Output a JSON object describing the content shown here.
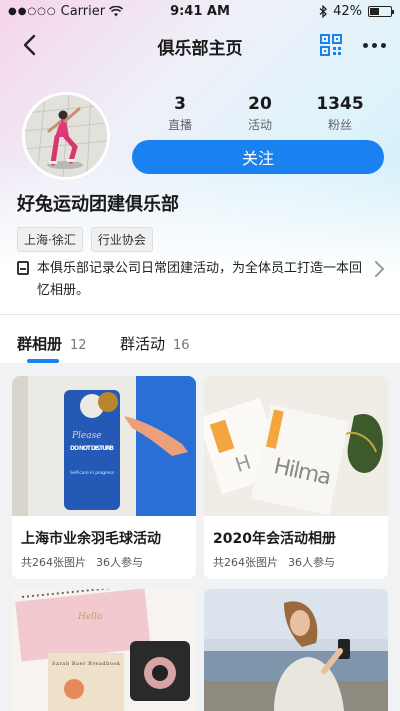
{
  "status": {
    "carrier": "Carrier",
    "time": "9:41 AM",
    "battery": "42%"
  },
  "nav": {
    "title": "俱乐部主页"
  },
  "stats": [
    {
      "num": "3",
      "label": "直播"
    },
    {
      "num": "20",
      "label": "活动"
    },
    {
      "num": "1345",
      "label": "粉丝"
    }
  ],
  "follow_label": "关注",
  "club": {
    "name": "好兔运动团建俱乐部",
    "tags": [
      "上海·徐汇",
      "行业协会"
    ],
    "description": "本俱乐部记录公司日常团建活动，为全体员工打造一本回忆相册。"
  },
  "tabs": [
    {
      "label": "群相册",
      "count": "12"
    },
    {
      "label": "群活动",
      "count": "16"
    }
  ],
  "albums": [
    {
      "title": "上海市业余羽毛球活动",
      "photos": "共264张图片",
      "members": "36人参与"
    },
    {
      "title": "2020年会活动相册",
      "photos": "共264张图片",
      "members": "36人参与"
    },
    {
      "title": "",
      "photos": "",
      "members": ""
    },
    {
      "title": "",
      "photos": "",
      "members": ""
    }
  ],
  "image_text": {
    "door_sign_top": "Please",
    "door_sign_main": "DO NOT DISTURB",
    "door_sign_sub": "Self-care in progress",
    "card_brand": "Hilma",
    "card_letter": "H",
    "notebook_label": "Hello",
    "book_title": "Sarah Baer Breadbook"
  },
  "colors": {
    "accent": "#1a82f0"
  }
}
